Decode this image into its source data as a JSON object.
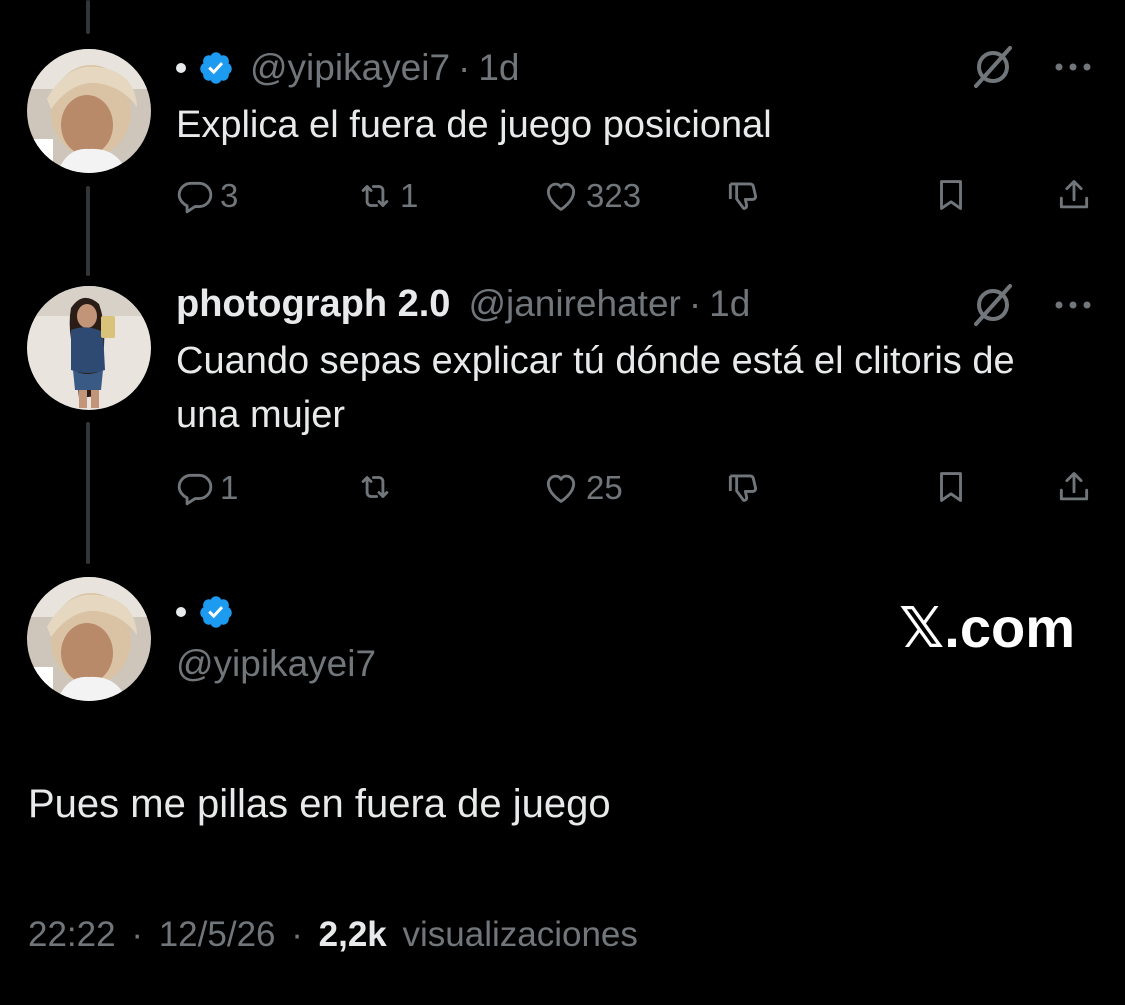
{
  "colors": {
    "background": "#000000",
    "text": "#e7e9ea",
    "muted": "#71767b",
    "verified": "#1d9bf0",
    "thread_line": "#333639"
  },
  "tweets": [
    {
      "display_name": "",
      "handle": "@yipikayei7",
      "time": "1d",
      "verified": true,
      "text": "Explica el fuera de juego posicional",
      "replies": "3",
      "retweets": "1",
      "likes": "323"
    },
    {
      "display_name": "photograph 2.0",
      "handle": "@janirehater",
      "time": "1d",
      "verified": false,
      "text": "Cuando sepas explicar tú dónde está el clitoris de una mujer",
      "replies": "1",
      "retweets": "",
      "likes": "25"
    }
  ],
  "main_tweet": {
    "handle": "@yipikayei7",
    "verified": true,
    "brand": "𝕏.com",
    "text": "Pues me pillas en fuera de juego",
    "time": "22:22",
    "date": "12/5/26",
    "views_count": "2,2k",
    "views_label": "visualizaciones",
    "separator": "·"
  },
  "icons": {
    "reply": "reply-icon",
    "retweet": "retweet-icon",
    "like": "heart-icon",
    "dislike": "dislike-icon",
    "bookmark": "bookmark-icon",
    "share": "share-icon",
    "grok": "grok-icon",
    "more": "more-icon",
    "verified": "verified-badge-icon"
  }
}
